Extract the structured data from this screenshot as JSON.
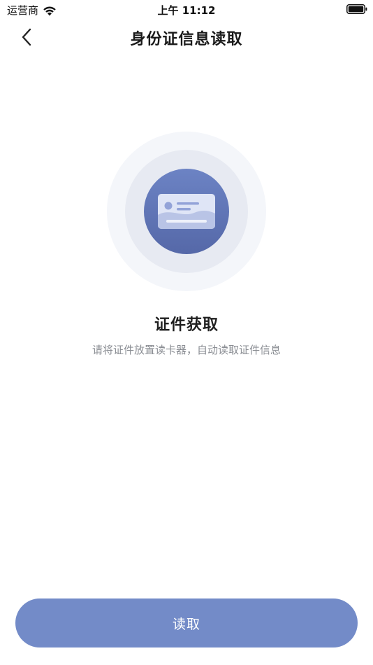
{
  "status_bar": {
    "carrier": "运营商",
    "time": "上午 11:12",
    "wifi_icon": "wifi-icon",
    "battery_icon": "battery-icon"
  },
  "nav": {
    "back_icon": "chevron-left-icon",
    "title": "身份证信息读取"
  },
  "illustration": {
    "icon": "id-card-icon",
    "accent_color": "#5e73b5",
    "ring_colors": [
      "#f4f6fa",
      "#e7eaf2"
    ]
  },
  "content": {
    "title": "证件获取",
    "description": "请将证件放置读卡器，自动读取证件信息"
  },
  "actions": {
    "read_label": "读取",
    "read_color": "#738bc8"
  }
}
